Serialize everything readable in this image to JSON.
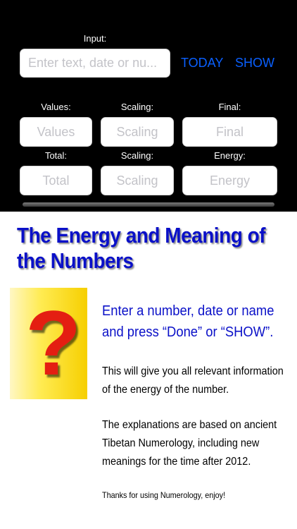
{
  "controls": {
    "input_label": "Input:",
    "input_placeholder": "Enter text, date or nu...",
    "today_button": "TODAY",
    "show_button": "SHOW",
    "row1_labels": [
      "Values:",
      "Scaling:",
      "Final:"
    ],
    "row1_placeholders": [
      "Values",
      "Scaling",
      "Final"
    ],
    "row2_labels": [
      "Total:",
      "Scaling:",
      "Energy:"
    ],
    "row2_placeholders": [
      "Total",
      "Scaling",
      "Energy"
    ]
  },
  "content": {
    "title": "The Energy and Meaning of the Numbers",
    "image_glyph": "?",
    "lead": "Enter a number, date or name and press “Done” or “SHOW”.",
    "para1": "This will give you all relevant information of the energy of the number.",
    "para2": "The explanations are based on ancient Tibetan Numerology, including new meanings for the time after 2012.",
    "footer": "Thanks for using Numerology, enjoy!"
  },
  "colors": {
    "accent": "#0a60ff",
    "title": "#0a10c8",
    "question_mark": "#e41e12"
  }
}
